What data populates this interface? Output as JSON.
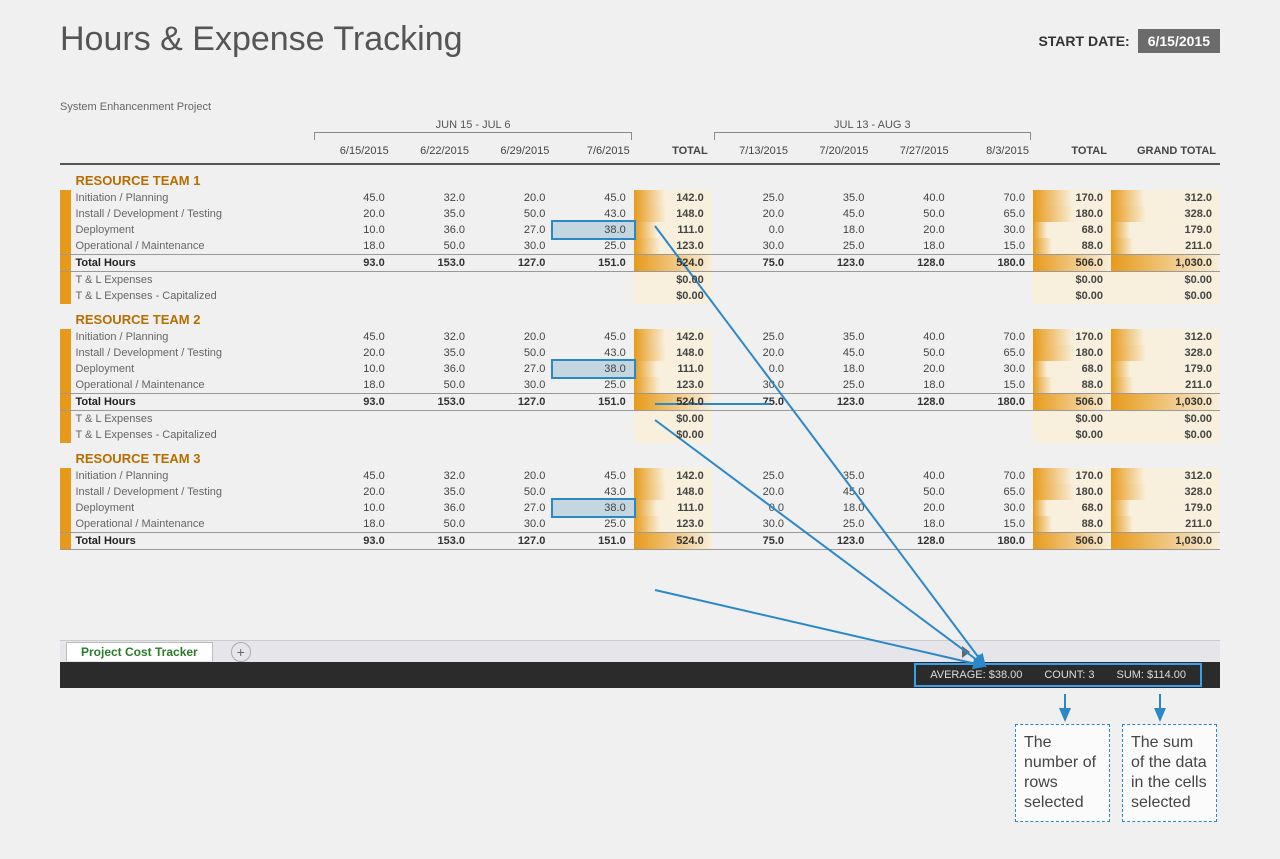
{
  "title": "Hours & Expense Tracking",
  "start_date_label": "START DATE:",
  "start_date": "6/15/2015",
  "project_name": "System Enhancenment Project",
  "period1_label": "JUN 15 - JUL 6",
  "period2_label": "JUL 13 - AUG 3",
  "date_cols1": [
    "6/15/2015",
    "6/22/2015",
    "6/29/2015",
    "7/6/2015"
  ],
  "date_cols2": [
    "7/13/2015",
    "7/20/2015",
    "7/27/2015",
    "8/3/2015"
  ],
  "col_total": "TOTAL",
  "col_grand": "GRAND TOTAL",
  "teams": [
    {
      "name": "RESOURCE TEAM 1"
    },
    {
      "name": "RESOURCE TEAM 2"
    },
    {
      "name": "RESOURCE TEAM 3"
    }
  ],
  "row_labels": {
    "r1": "Initiation / Planning",
    "r2": "Install / Development / Testing",
    "r3": "Deployment",
    "r4": "Operational / Maintenance",
    "rt": "Total Hours",
    "re1": "T & L Expenses",
    "re2": "T & L Expenses - Capitalized"
  },
  "rows": {
    "r1": {
      "p1": [
        "45.0",
        "32.0",
        "20.0",
        "45.0"
      ],
      "t1": "142.0",
      "p2": [
        "25.0",
        "35.0",
        "40.0",
        "70.0"
      ],
      "t2": "170.0",
      "gt": "312.0"
    },
    "r2": {
      "p1": [
        "20.0",
        "35.0",
        "50.0",
        "43.0"
      ],
      "t1": "148.0",
      "p2": [
        "20.0",
        "45.0",
        "50.0",
        "65.0"
      ],
      "t2": "180.0",
      "gt": "328.0"
    },
    "r3": {
      "p1": [
        "10.0",
        "36.0",
        "27.0",
        "38.0"
      ],
      "t1": "111.0",
      "p2": [
        "0.0",
        "18.0",
        "20.0",
        "30.0"
      ],
      "t2": "68.0",
      "gt": "179.0"
    },
    "r4": {
      "p1": [
        "18.0",
        "50.0",
        "30.0",
        "25.0"
      ],
      "t1": "123.0",
      "p2": [
        "30.0",
        "25.0",
        "18.0",
        "15.0"
      ],
      "t2": "88.0",
      "gt": "211.0"
    },
    "rt": {
      "p1": [
        "93.0",
        "153.0",
        "127.0",
        "151.0"
      ],
      "t1": "524.0",
      "p2": [
        "75.0",
        "123.0",
        "128.0",
        "180.0"
      ],
      "t2": "506.0",
      "gt": "1,030.0"
    },
    "re1": {
      "t1": "$0.00",
      "t2": "$0.00",
      "gt": "$0.00"
    },
    "re2": {
      "t1": "$0.00",
      "t2": "$0.00",
      "gt": "$0.00"
    }
  },
  "tab_name": "Project Cost Tracker",
  "stats": {
    "avg": "AVERAGE: $38.00",
    "count": "COUNT: 3",
    "sum": "SUM: $114.00"
  },
  "callout1": "The number of rows selected",
  "callout2": "The sum of the data in the cells selected"
}
